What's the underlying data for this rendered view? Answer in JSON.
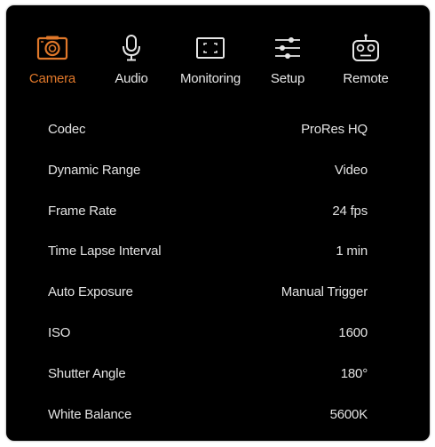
{
  "tabs": [
    {
      "label": "Camera",
      "icon": "camera-icon",
      "active": true
    },
    {
      "label": "Audio",
      "icon": "microphone-icon",
      "active": false
    },
    {
      "label": "Monitoring",
      "icon": "monitor-frame-icon",
      "active": false
    },
    {
      "label": "Setup",
      "icon": "sliders-icon",
      "active": false
    },
    {
      "label": "Remote",
      "icon": "robot-remote-icon",
      "active": false
    }
  ],
  "settings": [
    {
      "name": "Codec",
      "value": "ProRes HQ"
    },
    {
      "name": "Dynamic Range",
      "value": "Video"
    },
    {
      "name": "Frame Rate",
      "value": "24 fps"
    },
    {
      "name": "Time Lapse Interval",
      "value": "1 min"
    },
    {
      "name": "Auto Exposure",
      "value": "Manual Trigger"
    },
    {
      "name": "ISO",
      "value": "1600"
    },
    {
      "name": "Shutter Angle",
      "value": "180°"
    },
    {
      "name": "White Balance",
      "value": "5600K"
    }
  ],
  "colors": {
    "accent": "#e0782a",
    "background": "#000000",
    "text": "#e2e2e2"
  }
}
